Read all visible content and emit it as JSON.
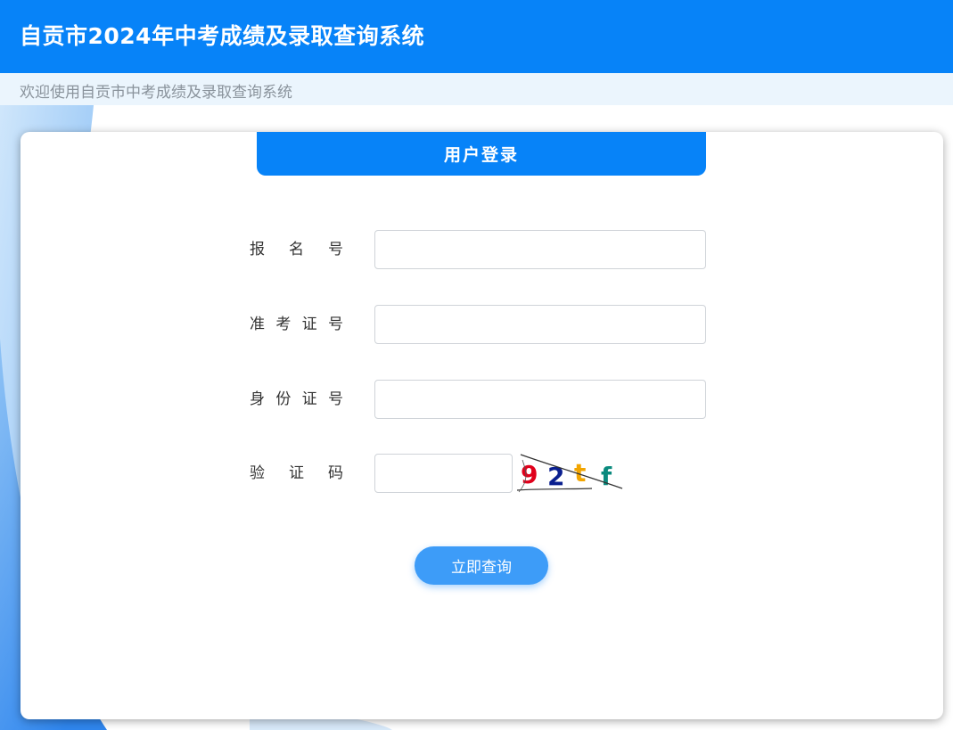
{
  "header": {
    "title": "自贡市2024年中考成绩及录取查询系统"
  },
  "subbar": {
    "welcome": "欢迎使用自贡市中考成绩及录取查询系统"
  },
  "login": {
    "title": "用户登录",
    "fields": [
      {
        "label": "报名号",
        "value": "",
        "placeholder": ""
      },
      {
        "label": "准考证号",
        "value": "",
        "placeholder": ""
      },
      {
        "label": "身份证号",
        "value": "",
        "placeholder": ""
      },
      {
        "label": "验证码",
        "value": "",
        "placeholder": ""
      }
    ],
    "captcha": {
      "chars": [
        "9",
        "2",
        "t",
        "f"
      ],
      "colors": [
        "#e0001b",
        "#0a1f8f",
        "#f2a500",
        "#0b8a7e"
      ]
    },
    "submit_label": "立即查询"
  },
  "colors": {
    "primary": "#0783f8",
    "button": "#3d9cf8",
    "subbar_bg": "#ebf5fd"
  }
}
